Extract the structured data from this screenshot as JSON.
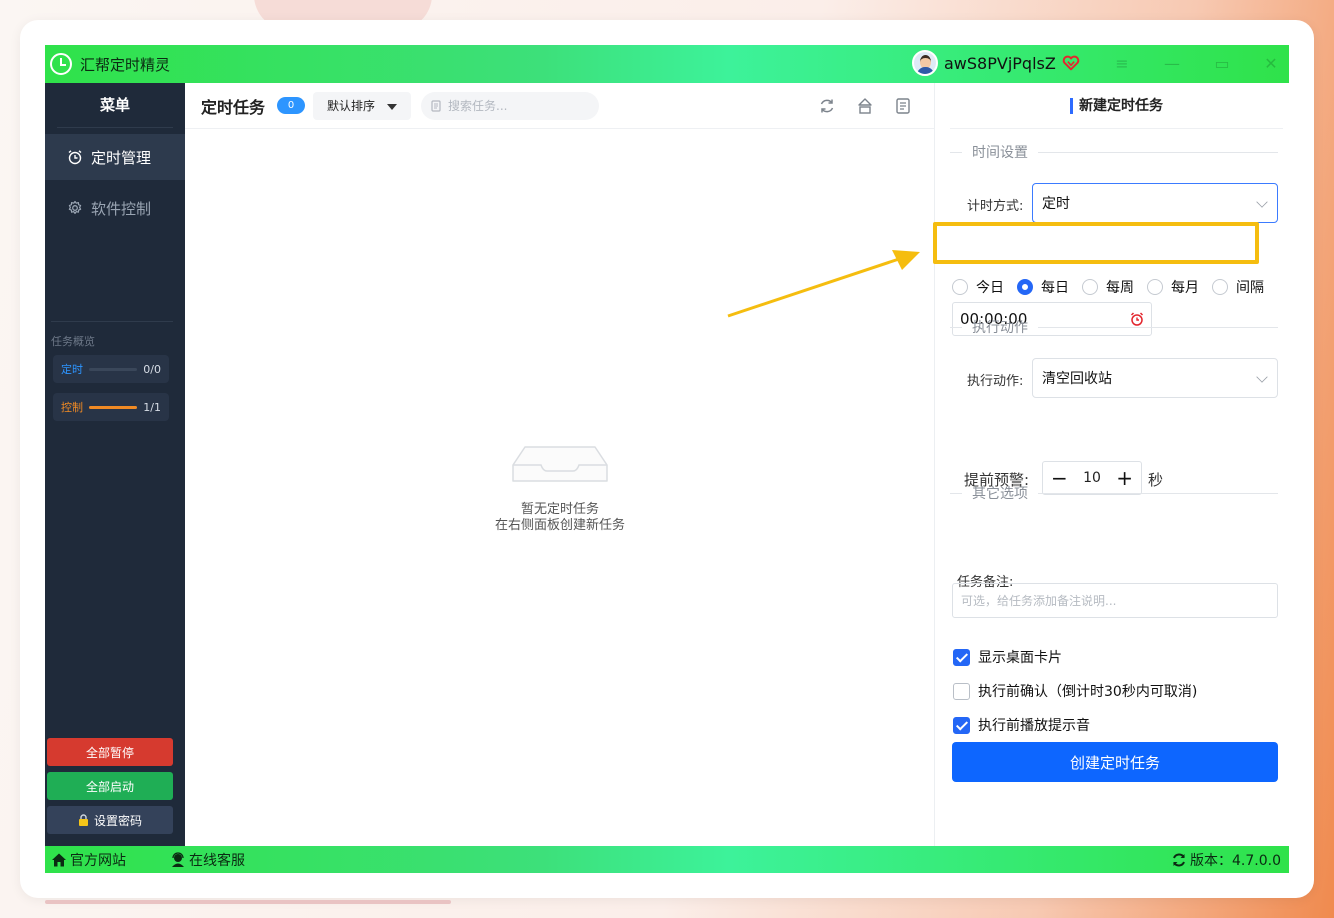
{
  "window": {
    "title": "汇帮定时精灵",
    "username": "awS8PVjPqlsZ"
  },
  "sidebar": {
    "menu_title": "菜单",
    "items": [
      {
        "label": "定时管理",
        "icon": "alarm-clock-icon",
        "active": true
      },
      {
        "label": "软件控制",
        "icon": "gear-icon",
        "active": false
      }
    ],
    "overview_title": "任务概览",
    "overview": [
      {
        "label": "定时",
        "count": "0/0",
        "progress": 0,
        "color": "#2d95ff"
      },
      {
        "label": "控制",
        "count": "1/1",
        "progress": 1,
        "color": "#f08a24"
      }
    ],
    "buttons": {
      "pause_all": "全部暂停",
      "start_all": "全部启动",
      "set_password": "设置密码"
    }
  },
  "center": {
    "title": "定时任务",
    "count_badge": "0",
    "sort_label": "默认排序",
    "search_placeholder": "搜索任务...",
    "empty_line1": "暂无定时任务",
    "empty_line2": "在右侧面板创建新任务"
  },
  "right_panel": {
    "title": "新建定时任务",
    "section_time": "时间设置",
    "timing_mode_label": "计时方式:",
    "timing_mode_value": "定时",
    "repeat_options": [
      {
        "label": "今日",
        "selected": false
      },
      {
        "label": "每日",
        "selected": true
      },
      {
        "label": "每周",
        "selected": false
      },
      {
        "label": "每月",
        "selected": false
      },
      {
        "label": "间隔",
        "selected": false
      }
    ],
    "time_value": "00:00:00",
    "section_action": "执行动作",
    "action_label": "执行动作:",
    "action_value": "清空回收站",
    "warn_label": "提前预警:",
    "warn_value": "10",
    "warn_unit": "秒",
    "section_other": "其它选项",
    "note_label": "任务备注:",
    "note_placeholder": "可选，给任务添加备注说明...",
    "checkboxes": [
      {
        "label": "显示桌面卡片",
        "checked": true
      },
      {
        "label": "执行前确认（倒计时30秒内可取消)",
        "checked": false
      },
      {
        "label": "执行前播放提示音",
        "checked": true
      }
    ],
    "create_button": "创建定时任务"
  },
  "statusbar": {
    "website": "官方网站",
    "support": "在线客服",
    "version": "版本：4.7.0.0"
  },
  "colors": {
    "accent_blue": "#0d66ff",
    "highlight_yellow": "#f5bd0f",
    "titlebar_green": "#2fe24a",
    "sidebar_bg": "#1f2a3a",
    "pause_red": "#d63a2f",
    "start_green": "#1fae55"
  }
}
